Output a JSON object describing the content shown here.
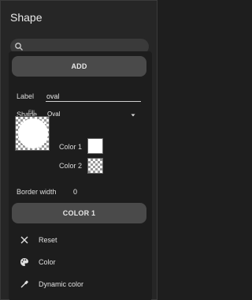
{
  "panel": {
    "title": "Shape"
  },
  "search": {
    "placeholder": ""
  },
  "buttons": {
    "add_label": "ADD",
    "color1_label": "COLOR 1"
  },
  "form": {
    "label_caption": "Label",
    "label_value": "oval",
    "shape_caption": "Shape",
    "shape_value": "Oval",
    "fill_caption": "Fill",
    "color1_caption": "Color 1",
    "color2_caption": "Color 2",
    "border_width_caption": "Border width",
    "border_width_value": "0"
  },
  "menu": [
    {
      "label": "Reset",
      "icon": "close-icon"
    },
    {
      "label": "Color",
      "icon": "palette-icon"
    },
    {
      "label": "Dynamic color",
      "icon": "eyedropper-icon"
    }
  ],
  "colors": {
    "background": "#262626",
    "button": "#4a4a4a",
    "color1": "#ffffff"
  }
}
